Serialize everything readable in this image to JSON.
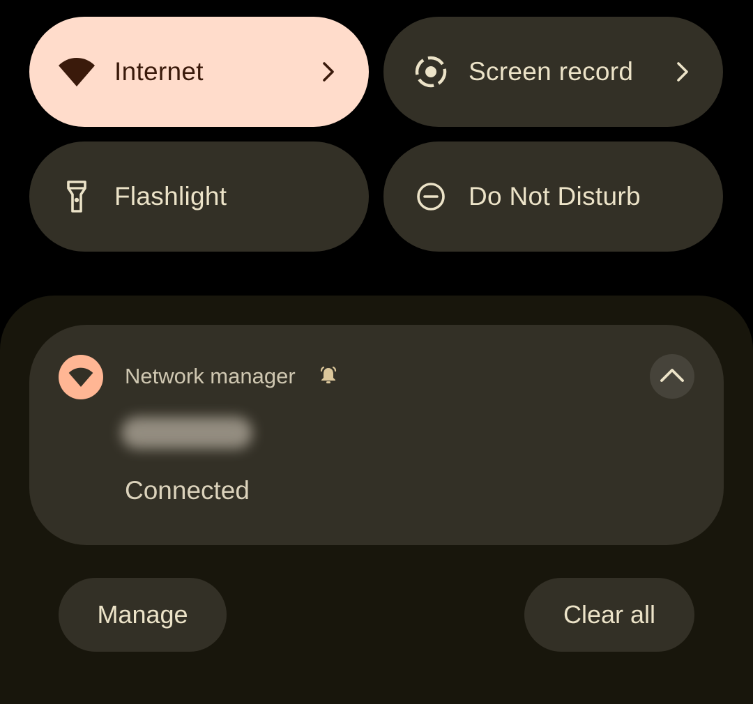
{
  "quick_settings": {
    "tiles": [
      {
        "label": "Internet",
        "icon": "wifi-icon",
        "active": true,
        "has_chevron": true
      },
      {
        "label": "Screen record",
        "icon": "screen-record-icon",
        "active": false,
        "has_chevron": true
      },
      {
        "label": "Flashlight",
        "icon": "flashlight-icon",
        "active": false,
        "has_chevron": false
      },
      {
        "label": "Do Not Disturb",
        "icon": "do-not-disturb-icon",
        "active": false,
        "has_chevron": false
      }
    ]
  },
  "notification": {
    "app_name": "Network manager",
    "app_icon": "wifi-icon",
    "alert_icon": "bell-icon",
    "title": "",
    "text": "Connected",
    "expand_icon": "chevron-up-icon"
  },
  "actions": {
    "manage_label": "Manage",
    "clear_all_label": "Clear all"
  },
  "colors": {
    "active_tile": "#FFDCCB",
    "inactive_tile": "#333026",
    "app_icon_bg": "#FFB694",
    "shade_bg": "#18160C"
  }
}
